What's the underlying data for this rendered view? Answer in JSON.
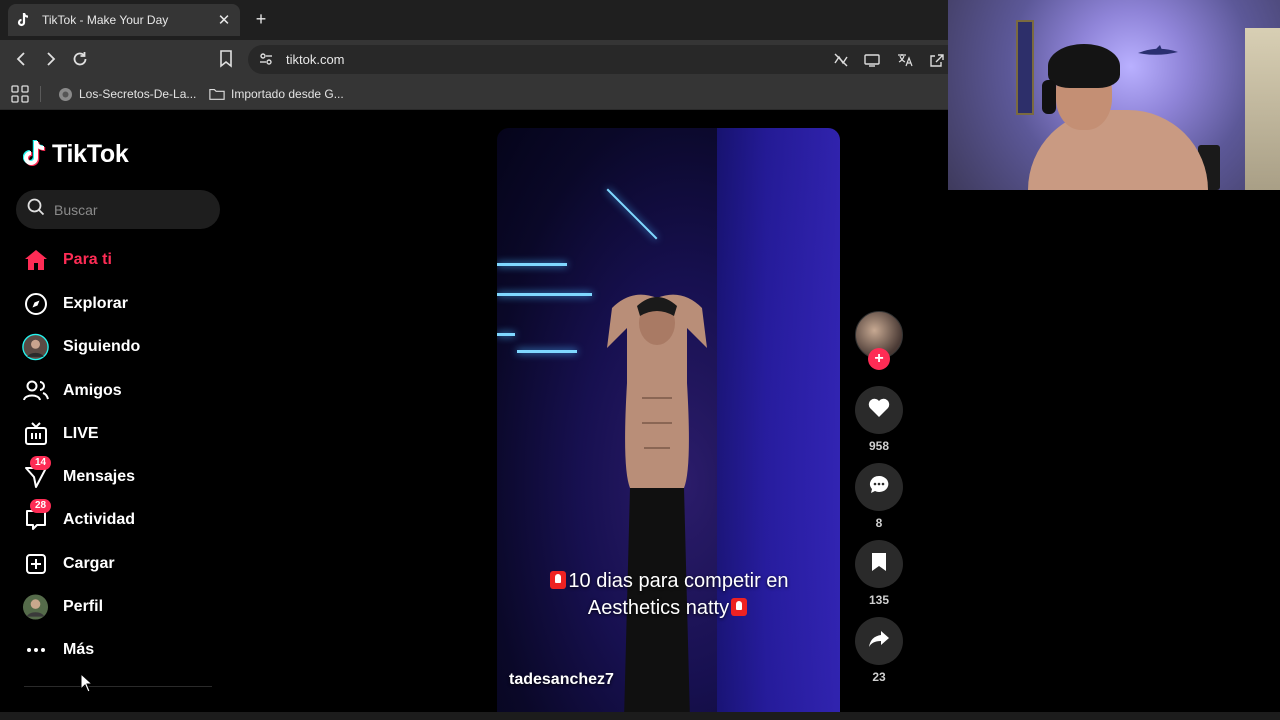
{
  "browser": {
    "tab_title": "TikTok - Make Your Day",
    "url": "tiktok.com",
    "bookmarks": [
      {
        "label": "Los-Secretos-De-La...",
        "icon": "globe-icon"
      },
      {
        "label": "Importado desde G...",
        "icon": "folder-icon"
      }
    ]
  },
  "tiktok": {
    "logo_text": "TikTok",
    "search_placeholder": "Buscar",
    "nav": [
      {
        "label": "Para ti",
        "icon": "home-icon",
        "active": true
      },
      {
        "label": "Explorar",
        "icon": "compass-icon"
      },
      {
        "label": "Siguiendo",
        "icon": "following-avatar-icon"
      },
      {
        "label": "Amigos",
        "icon": "friends-icon"
      },
      {
        "label": "LIVE",
        "icon": "live-icon"
      },
      {
        "label": "Mensajes",
        "icon": "messages-icon",
        "badge": "14"
      },
      {
        "label": "Actividad",
        "icon": "activity-icon",
        "badge": "28"
      },
      {
        "label": "Cargar",
        "icon": "upload-icon"
      },
      {
        "label": "Perfil",
        "icon": "profile-avatar-icon"
      },
      {
        "label": "Más",
        "icon": "more-icon"
      }
    ],
    "accent_color": "#fe2c55",
    "video": {
      "caption_line1": "10 dias para competir en",
      "caption_line2": "Aesthetics natty",
      "author": "tadesanchez7"
    },
    "actions": {
      "likes": "958",
      "comments": "8",
      "saves": "135",
      "shares": "23"
    }
  }
}
